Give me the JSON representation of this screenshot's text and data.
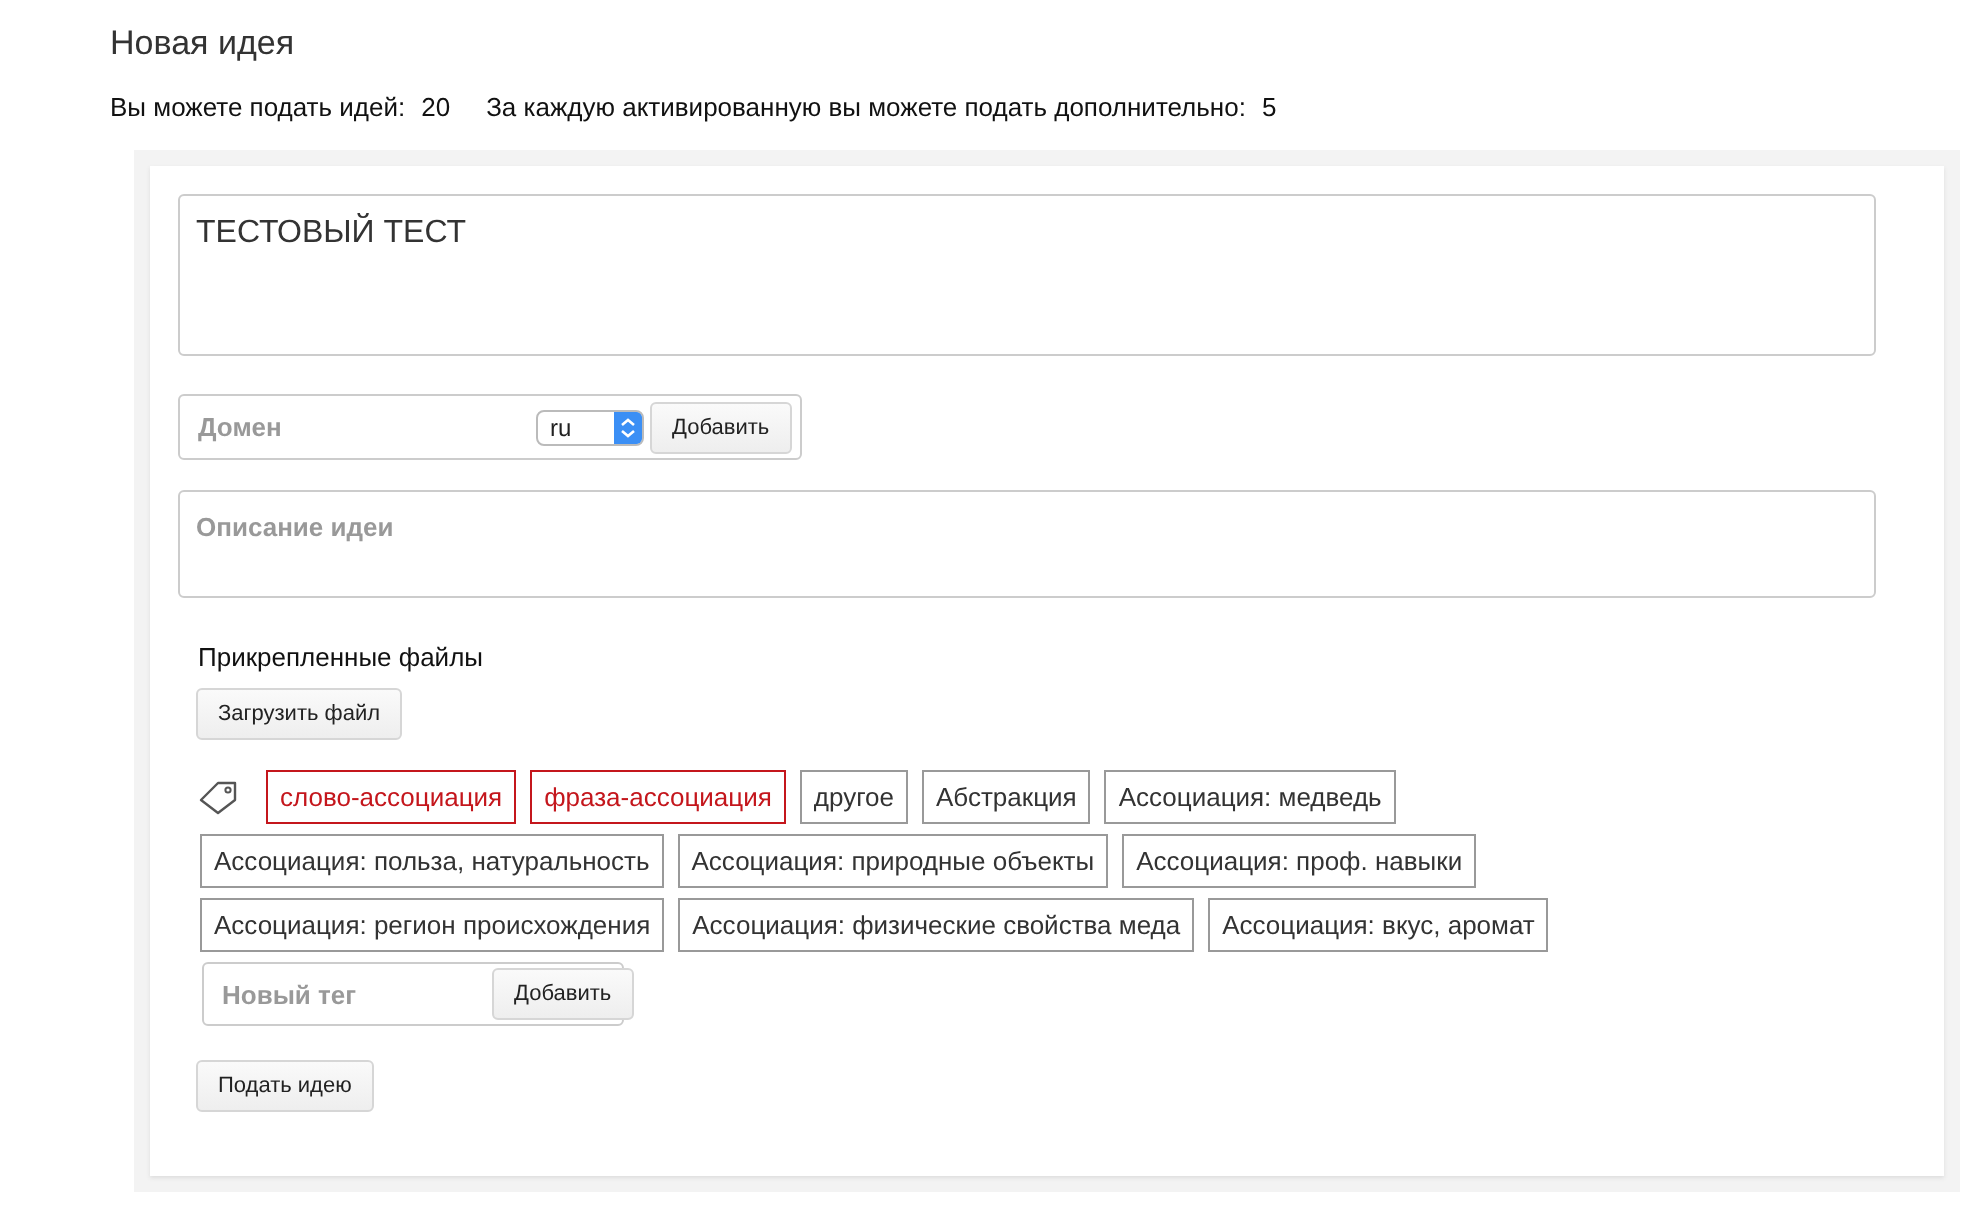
{
  "heading": "Новая идея",
  "limits": [
    {
      "label": "Вы можете подать идей:",
      "value": "20"
    },
    {
      "label": "За каждую активированную вы можете подать дополнительно:",
      "value": "5"
    }
  ],
  "title_field": {
    "value": "ТЕСТОВЫЙ ТЕСТ"
  },
  "domain": {
    "placeholder": "Домен",
    "zone": "ru",
    "button": "Добавить"
  },
  "description": {
    "placeholder": "Описание идеи"
  },
  "attachments": {
    "label": "Прикрепленные файлы",
    "button": "Загрузить файл"
  },
  "tags": [
    {
      "label": "слово-ассоциация",
      "selected": true
    },
    {
      "label": "фраза-ассоциация",
      "selected": true
    },
    {
      "label": "другое",
      "selected": false
    },
    {
      "label": "Абстракция",
      "selected": false
    },
    {
      "label": "Ассоциация: медведь",
      "selected": false
    },
    {
      "label": "Ассоциация: польза, натуральность",
      "selected": false
    },
    {
      "label": "Ассоциация: природные объекты",
      "selected": false
    },
    {
      "label": "Ассоциация: проф. навыки",
      "selected": false
    },
    {
      "label": "Ассоциация: регион происхождения",
      "selected": false
    },
    {
      "label": "Ассоциация: физические свойства меда",
      "selected": false
    },
    {
      "label": "Ассоциация: вкус, аромат",
      "selected": false
    }
  ],
  "new_tag": {
    "placeholder": "Новый тег",
    "button": "Добавить"
  },
  "submit": "Подать идею"
}
